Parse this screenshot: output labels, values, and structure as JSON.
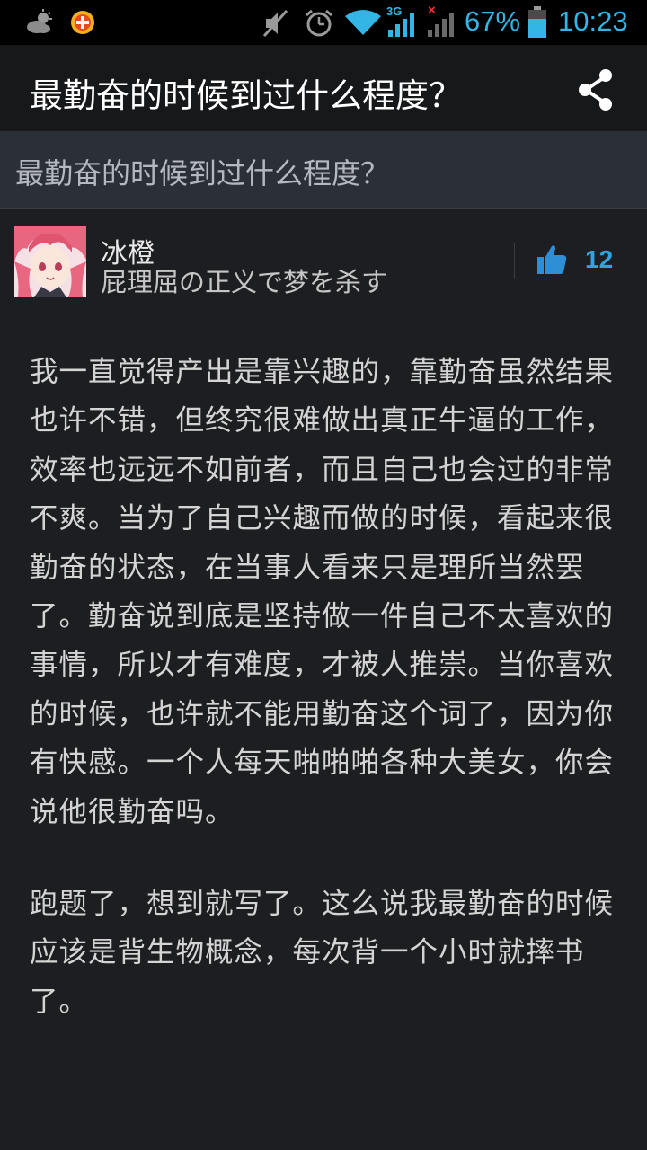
{
  "status_bar": {
    "battery": "67%",
    "time": "10:23",
    "network": "3G",
    "icons": [
      "weather-icon",
      "app-notification-icon",
      "mute-icon",
      "alarm-icon",
      "wifi-icon",
      "signal-3g-icon",
      "no-signal-icon",
      "battery-icon"
    ]
  },
  "action_bar": {
    "title": "最勤奋的时候到过什么程度？",
    "share_icon": "share-icon"
  },
  "question": {
    "title": "最勤奋的时候到过什么程度？"
  },
  "author": {
    "name": "冰橙",
    "bio": "屁理屈の正义で梦を杀す",
    "votes": "12"
  },
  "answer": {
    "paragraphs": [
      "我一直觉得产出是靠兴趣的，靠勤奋虽然结果也许不错，但终究很难做出真正牛逼的工作，效率也远远不如前者，而且自己也会过的非常不爽。当为了自己兴趣而做的时候，看起来很勤奋的状态，在当事人看来只是理所当然罢了。勤奋说到底是坚持做一件自己不太喜欢的事情，所以才有难度，才被人推崇。当你喜欢的时候，也许就不能用勤奋这个词了，因为你有快感。一个人每天啪啪啪各种大美女，你会说他很勤奋吗。",
      "跑题了，想到就写了。这么说我最勤奋的时候应该是背生物概念，每次背一个小时就摔书了。"
    ]
  },
  "colors": {
    "background": "#1d1e21",
    "accent": "#33b5e5",
    "question_bg": "#2b3036"
  }
}
